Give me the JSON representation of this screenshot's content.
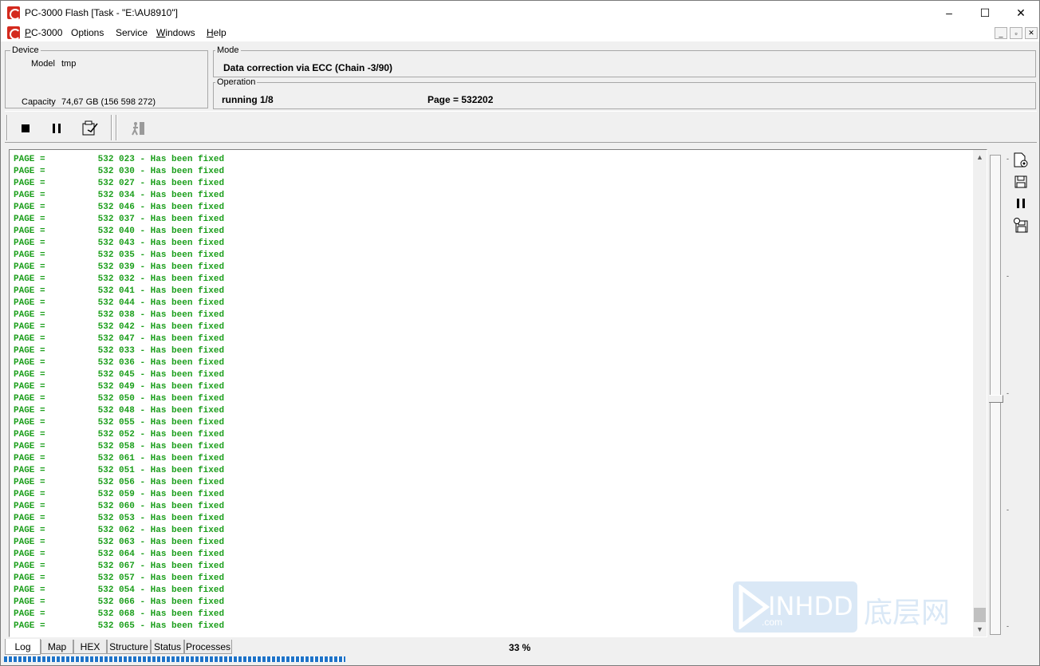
{
  "window": {
    "title": "PC-3000 Flash [Task - \"E:\\AU8910\"]",
    "minimize": "–",
    "maximize": "☐",
    "close": "✕"
  },
  "menu": {
    "items": [
      "PC-3000",
      "Options",
      "Service",
      "Windows",
      "Help"
    ],
    "mdi": [
      "_",
      "▫",
      "✕"
    ]
  },
  "device": {
    "legend": "Device",
    "model_label": "Model",
    "model_value": "tmp",
    "capacity_label": "Capacity",
    "capacity_value": "74,67 GB (156 598 272)"
  },
  "mode": {
    "legend": "Mode",
    "value": "Data correction via ECC (Chain -3/90)"
  },
  "operation": {
    "legend": "Operation",
    "status": "running 1/8",
    "page": "Page = 532202"
  },
  "log": {
    "prefix": "PAGE =",
    "suffix": "- Has been fixed",
    "pages": [
      "532 023",
      "532 030",
      "532 027",
      "532 034",
      "532 046",
      "532 037",
      "532 040",
      "532 043",
      "532 035",
      "532 039",
      "532 032",
      "532 041",
      "532 044",
      "532 038",
      "532 042",
      "532 047",
      "532 033",
      "532 036",
      "532 045",
      "532 049",
      "532 050",
      "532 048",
      "532 055",
      "532 052",
      "532 058",
      "532 061",
      "532 051",
      "532 056",
      "532 059",
      "532 060",
      "532 053",
      "532 062",
      "532 063",
      "532 064",
      "532 067",
      "532 057",
      "532 054",
      "532 066",
      "532 068",
      "532 065"
    ]
  },
  "tabs": [
    "Log",
    "Map",
    "HEX",
    "Structure",
    "Status",
    "Processes"
  ],
  "progress": {
    "percent_label": "33 %",
    "fraction": 0.33
  },
  "watermark": {
    "text": "INHDD",
    "sub": ".com",
    "cn": "底层网"
  },
  "colors": {
    "log_text": "#1a9e1a",
    "progress": "#1e73c8",
    "app_icon": "#d42a1e"
  }
}
